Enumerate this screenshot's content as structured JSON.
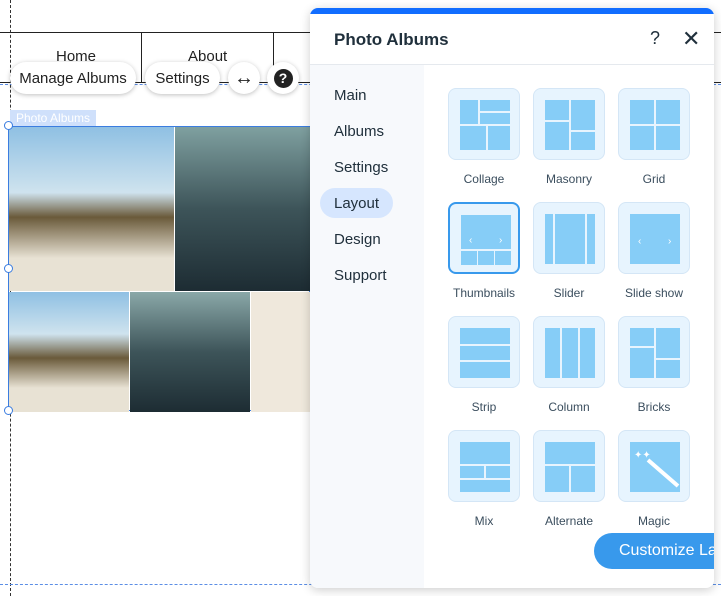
{
  "site_nav": {
    "items": [
      "Home",
      "About"
    ]
  },
  "floating_toolbar": {
    "manage_albums": "Manage Albums",
    "settings": "Settings",
    "stretch_icon": "left-right-arrow-icon",
    "help_icon": "question-circle-icon"
  },
  "component_label": "Photo Albums",
  "panel": {
    "title": "Photo Albums",
    "help_icon": "question-icon",
    "close_icon": "close-icon",
    "sidebar": [
      {
        "label": "Main"
      },
      {
        "label": "Albums"
      },
      {
        "label": "Settings"
      },
      {
        "label": "Layout",
        "active": true
      },
      {
        "label": "Design"
      },
      {
        "label": "Support"
      }
    ],
    "layouts": [
      {
        "label": "Collage"
      },
      {
        "label": "Masonry"
      },
      {
        "label": "Grid"
      },
      {
        "label": "Thumbnails",
        "selected": true
      },
      {
        "label": "Slider"
      },
      {
        "label": "Slide show"
      },
      {
        "label": "Strip"
      },
      {
        "label": "Column"
      },
      {
        "label": "Bricks"
      },
      {
        "label": "Mix"
      },
      {
        "label": "Alternate"
      },
      {
        "label": "Magic"
      }
    ],
    "customize_button": "Customize Layout",
    "accent": "#3899ec"
  }
}
